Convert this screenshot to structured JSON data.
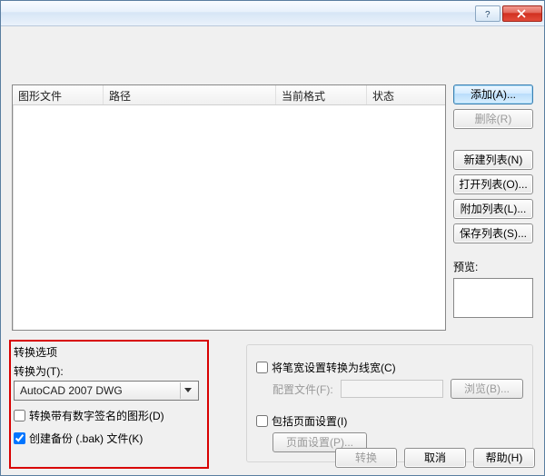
{
  "columns": {
    "file": "图形文件",
    "path": "路径",
    "format": "当前格式",
    "status": "状态"
  },
  "buttons": {
    "add": "添加(A)...",
    "remove": "删除(R)",
    "new_list": "新建列表(N)",
    "open_list": "打开列表(O)...",
    "append": "附加列表(L)...",
    "save_list": "保存列表(S)...",
    "browse": "浏览(B)...",
    "convert": "转换",
    "cancel": "取消",
    "help": "帮助(H)"
  },
  "labels": {
    "preview": "预览:",
    "conv_title": "转换选项",
    "convert_to": "转换为(T):",
    "combo_value": "AutoCAD 2007 DWG",
    "chk_digsig": "转换带有数字签名的图形(D)",
    "chk_bak": "创建备份 (.bak) 文件(K)",
    "chk_lineweight": "将笔宽设置转换为线宽(C)",
    "config_file": "配置文件(F):",
    "chk_pagesetup": "包括页面设置(I)",
    "page_setup_btn": "页面设置(P)..."
  },
  "state": {
    "chk_digsig": false,
    "chk_bak": true,
    "chk_lineweight": false,
    "chk_pagesetup": false
  }
}
